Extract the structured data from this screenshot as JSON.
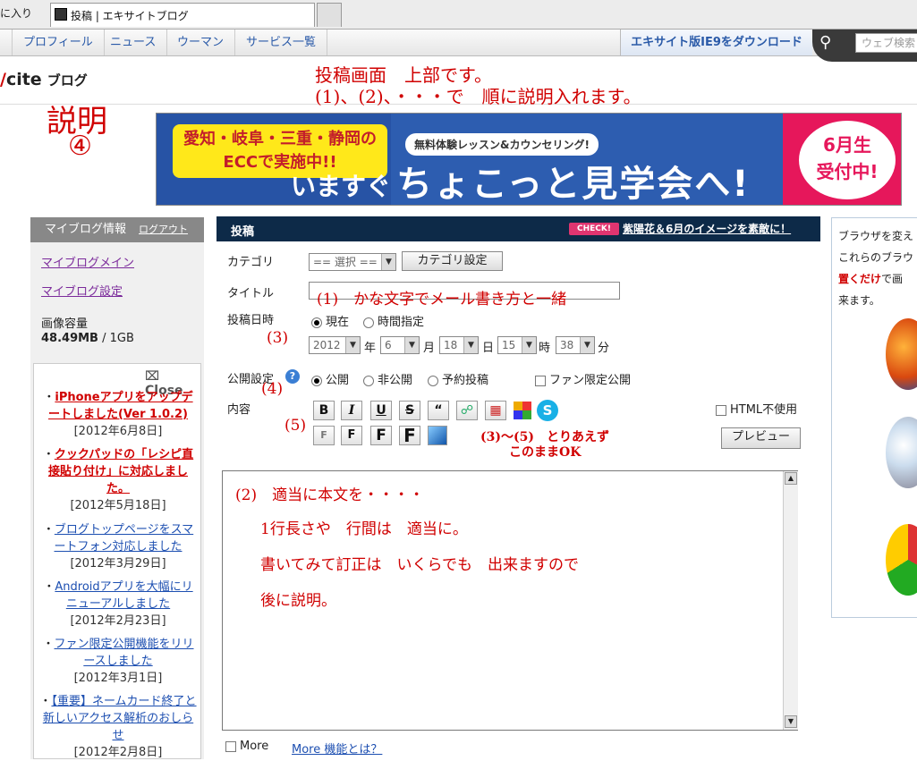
{
  "browser": {
    "favorites_label": "に入り",
    "tab_title": "投稿 | エキサイトブログ"
  },
  "nav": {
    "items": [
      "プロフィール",
      "ニュース",
      "ウーマン",
      "サービス一覧"
    ],
    "download_label": "エキサイト版IE9をダウンロード",
    "search_placeholder": "ウェブ検索"
  },
  "logo": {
    "prefix": "cite",
    "suffix": "ブログ"
  },
  "annotations": {
    "top_line1": "投稿画面　上部です。",
    "top_line2": "(1)、(2)、・・・で　順に説明入れます。",
    "setsumei": "説明",
    "setsumei_num": "④",
    "n3": "(3)",
    "n4": "(4)",
    "n5": "(5)",
    "n35_line1": "(3)～(5)　とりあえず",
    "n35_line2": "このままOK"
  },
  "banner": {
    "region_text": "愛知・岐阜・三重・静岡の\nECCで実施中!!",
    "now_text": "いますぐ",
    "free_text": "無料体験レッスン&カウンセリング!",
    "main_text": "ちょこっと見学会へ!",
    "badge_line1": "6月生",
    "badge_line2": "受付中!"
  },
  "sidebar": {
    "header": "マイブログ情報",
    "logout": "ログアウト",
    "link_main": "マイブログメイン",
    "link_settings": "マイブログ設定",
    "capacity_label": "画像容量",
    "capacity_used": "48.49MB",
    "capacity_total": " / 1GB",
    "close_label": "Close",
    "news": [
      {
        "title": "iPhoneアプリをアップデートしました(Ver 1.0.2)",
        "date": "[2012年6月8日]",
        "hot": true
      },
      {
        "title": "クックパッドの「レシピ直接貼り付け」に対応しました。",
        "date": "[2012年5月18日]",
        "hot": true
      },
      {
        "title": "ブログトップページをスマートフォン対応しました",
        "date": "[2012年3月29日]",
        "hot": false
      },
      {
        "title": "Androidアプリを大幅にリニューアルしました",
        "date": "[2012年2月23日]",
        "hot": false
      },
      {
        "title": "ファン限定公開機能をリリースしました",
        "date": "[2012年3月1日]",
        "hot": false
      },
      {
        "title": "【重要】ネームカード終了と新しいアクセス解析のおしらせ",
        "date": "[2012年2月8日]",
        "hot": false
      }
    ]
  },
  "post": {
    "header": "投稿",
    "check_badge": "CHECK!",
    "check_link": "紫陽花＆6月のイメージを素敵に！",
    "category_label": "カテゴリ",
    "category_value": "== 選択 ==",
    "category_button": "カテゴリ設定",
    "title_label": "タイトル",
    "title_value": "(1)　かな文字でメール書き方と一緒",
    "date_label": "投稿日時",
    "date_now": "現在",
    "date_specify": "時間指定",
    "year": "2012",
    "year_unit": "年",
    "month": "6",
    "month_unit": "月",
    "day": "18",
    "day_unit": "日",
    "hour": "15",
    "hour_unit": "時",
    "minute": "38",
    "minute_unit": "分",
    "visibility_label": "公開設定",
    "vis_public": "公開",
    "vis_private": "非公開",
    "vis_scheduled": "予約投稿",
    "vis_fan": "ファン限定公開",
    "content_label": "内容",
    "html_off": "HTML不使用",
    "preview_button": "プレビュー",
    "body_lines": [
      "(2)　適当に本文を・・・・",
      "1行長さや　行間は　適当に。",
      "書いてみて訂正は　いくらでも　出来ますので",
      "後に説明。"
    ],
    "more_label": "More",
    "more_link": "More 機能とは？"
  },
  "right_panel": {
    "line1": "ブラウザを変え",
    "line2": "これらのブラウ",
    "line3_bold": "置くだけ",
    "line3_rest": "で画",
    "line4": "来ます。"
  }
}
